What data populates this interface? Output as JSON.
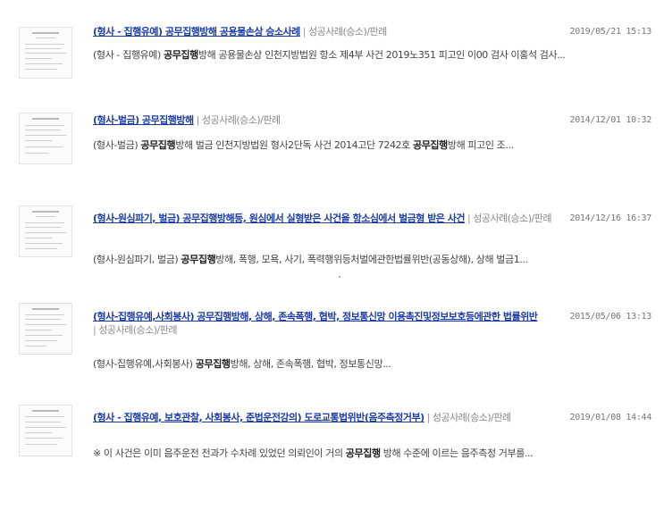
{
  "results": [
    {
      "title": "(형사 - 집행유예) 공무집행방해 공용물손상 승소사례",
      "separator": "|",
      "category": "성공사례(승소)/판례",
      "date": "2019/05/21 15:13",
      "snippet": [
        {
          "t": "(형사 - 집행유예) ",
          "b": false
        },
        {
          "t": "공무집행",
          "b": true
        },
        {
          "t": "방해 공용물손상 인천지방법원 항소 제4부 사건 2019노351 피고인 이00 검사 이홍석 검사...",
          "b": false
        }
      ]
    },
    {
      "title": "(형사-벌금) 공무집행방해",
      "separator": "|",
      "category": "성공사례(승소)/판례",
      "date": "2014/12/01 10:32",
      "snippet": [
        {
          "t": "(형사-벌금) ",
          "b": false
        },
        {
          "t": "공무집행",
          "b": true
        },
        {
          "t": "방해 벌금 인천지방법원 형사2단독 사건 2014고단 7242호 ",
          "b": false
        },
        {
          "t": "공무집행",
          "b": true
        },
        {
          "t": "방해 피고인 조...",
          "b": false
        }
      ]
    },
    {
      "title": "(형사-원심파기, 벌금) 공무집행방해등, 원심에서 실형받은 사건을 항소심에서 벌금형 받은 사건",
      "separator": "|",
      "category": "성공사례(승소)/판례",
      "date": "2014/12/16 16:37",
      "snippet": [
        {
          "t": "(형사-원심파기, 벌금) ",
          "b": false
        },
        {
          "t": "공무집행",
          "b": true
        },
        {
          "t": "방해, 폭행, 모욕, 사기, 폭력행위등처벌에관한법률위반(공동상해), 상해 벌금1...",
          "b": false
        }
      ]
    },
    {
      "title": "(형사-집행유예,사회봉사) 공무집행방해, 상해, 존속폭행, 협박, 정보통신망 이용촉진및정보보호등에관한 법률위반",
      "separator": "|",
      "category": "성공사례(승소)/판례",
      "date": "2015/05/06 13:13",
      "snippet": [
        {
          "t": "(형사-집행유예,사회봉사) ",
          "b": false
        },
        {
          "t": "공무집행",
          "b": true
        },
        {
          "t": "방해, 상해, 존속폭행, 협박, 정보통신망...",
          "b": false
        }
      ]
    },
    {
      "title": "(형사 - 집행유예, 보호관찰, 사회봉사, 준법운전강의) 도로교통법위반(음주측정거부)",
      "separator": "|",
      "category": "성공사례(승소)/판례",
      "date": "2019/01/08 14:44",
      "snippet": [
        {
          "t": "※ 이 사건은 이미 음주운전 전과가 수차례 있었던 의뢰인이 거의 ",
          "b": false
        },
        {
          "t": "공무집행",
          "b": true
        },
        {
          "t": " 방해 수준에 이르는 음주측정 거부를...",
          "b": false
        }
      ]
    }
  ]
}
